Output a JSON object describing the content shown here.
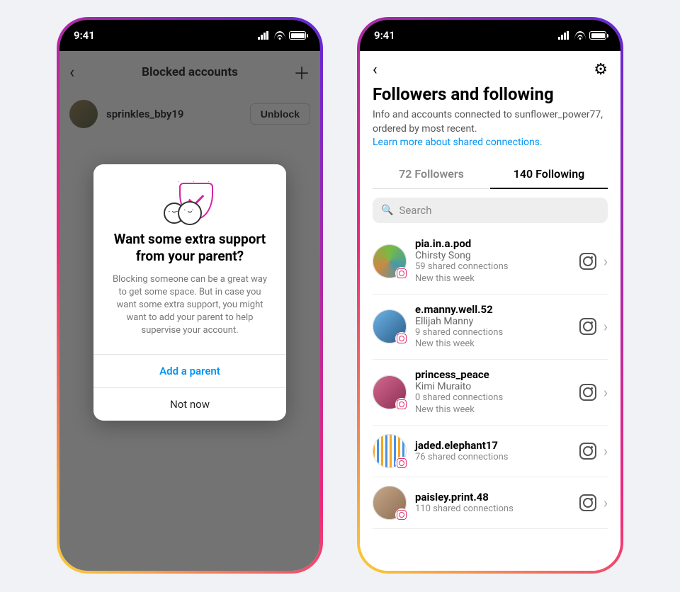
{
  "statusbar": {
    "time": "9:41"
  },
  "phone1": {
    "header_title": "Blocked accounts",
    "row_username": "sprinkles_bby19",
    "unblock_label": "Unblock",
    "modal": {
      "heading": "Want some extra support from your parent?",
      "body": "Blocking someone can be a great way to get some space. But in case you want some extra support, you might want to add your parent to help supervise your account.",
      "primary_btn": "Add a parent",
      "secondary_btn": "Not now"
    }
  },
  "phone2": {
    "title": "Followers and following",
    "subtitle_pre": "Info and accounts connected to ",
    "subtitle_user": "sunflower_power77",
    "subtitle_post": ", ordered by most recent.",
    "learn_more": "Learn more about shared connections.",
    "tabs": {
      "followers": "72 Followers",
      "following": "140 Following"
    },
    "search_placeholder": "Search",
    "items": [
      {
        "username": "pia.in.a.pod",
        "name": "Chirsty Song",
        "shared": "59 shared connections",
        "new": "New this week"
      },
      {
        "username": "e.manny.well.52",
        "name": "Ellijah Manny",
        "shared": "9 shared connections",
        "new": "New this week"
      },
      {
        "username": "princess_peace",
        "name": "Kimi Muraito",
        "shared": "0 shared connections",
        "new": "New this week"
      },
      {
        "username": "jaded.elephant17",
        "name": "",
        "shared": "76 shared connections",
        "new": ""
      },
      {
        "username": "paisley.print.48",
        "name": "",
        "shared": "110 shared connections",
        "new": ""
      }
    ]
  }
}
